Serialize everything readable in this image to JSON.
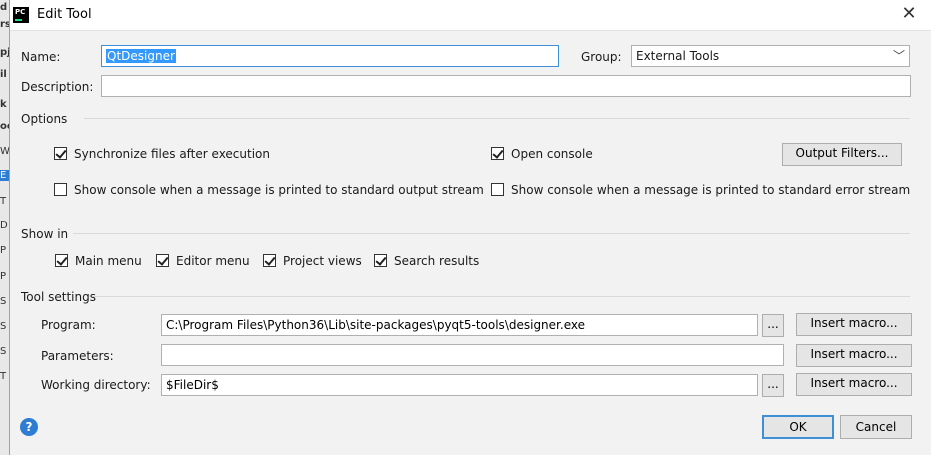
{
  "window": {
    "title": "Edit Tool",
    "app_icon": "PC"
  },
  "fields": {
    "name_label": "Name:",
    "name_value": "QtDesigner",
    "group_label": "Group:",
    "group_value": "External Tools",
    "description_label": "Description:",
    "description_value": ""
  },
  "options": {
    "header": "Options",
    "sync_files": {
      "label": "Synchronize files after execution",
      "checked": true
    },
    "open_console": {
      "label": "Open console",
      "checked": true
    },
    "output_filters_button": "Output Filters...",
    "show_console_stdout": {
      "label": "Show console when a message is printed to standard output stream",
      "checked": false
    },
    "show_console_stderr": {
      "label": "Show console when a message is printed to standard error stream",
      "checked": false
    }
  },
  "show_in": {
    "header": "Show in",
    "main_menu": {
      "label": "Main menu",
      "checked": true
    },
    "editor_menu": {
      "label": "Editor menu",
      "checked": true
    },
    "project_views": {
      "label": "Project views",
      "checked": true
    },
    "search_results": {
      "label": "Search results",
      "checked": true
    }
  },
  "tool_settings": {
    "header": "Tool settings",
    "program_label": "Program:",
    "program_value": "C:\\Program Files\\Python36\\Lib\\site-packages\\pyqt5-tools\\designer.exe",
    "parameters_label": "Parameters:",
    "parameters_value": "",
    "working_dir_label": "Working directory:",
    "working_dir_value": "$FileDir$",
    "browse_label": "...",
    "insert_macro_label": "Insert macro..."
  },
  "footer": {
    "help_label": "?",
    "ok_label": "OK",
    "cancel_label": "Cancel"
  },
  "background_fragments": [
    "d",
    "rs",
    "pj",
    "il",
    "k",
    "oc",
    "W",
    "E",
    "T",
    "D",
    "P",
    "P",
    "S",
    "S",
    "S",
    "T"
  ],
  "colors": {
    "accent": "#3d8fd6",
    "selection": "#3399ff",
    "help": "#2f7dd3"
  }
}
